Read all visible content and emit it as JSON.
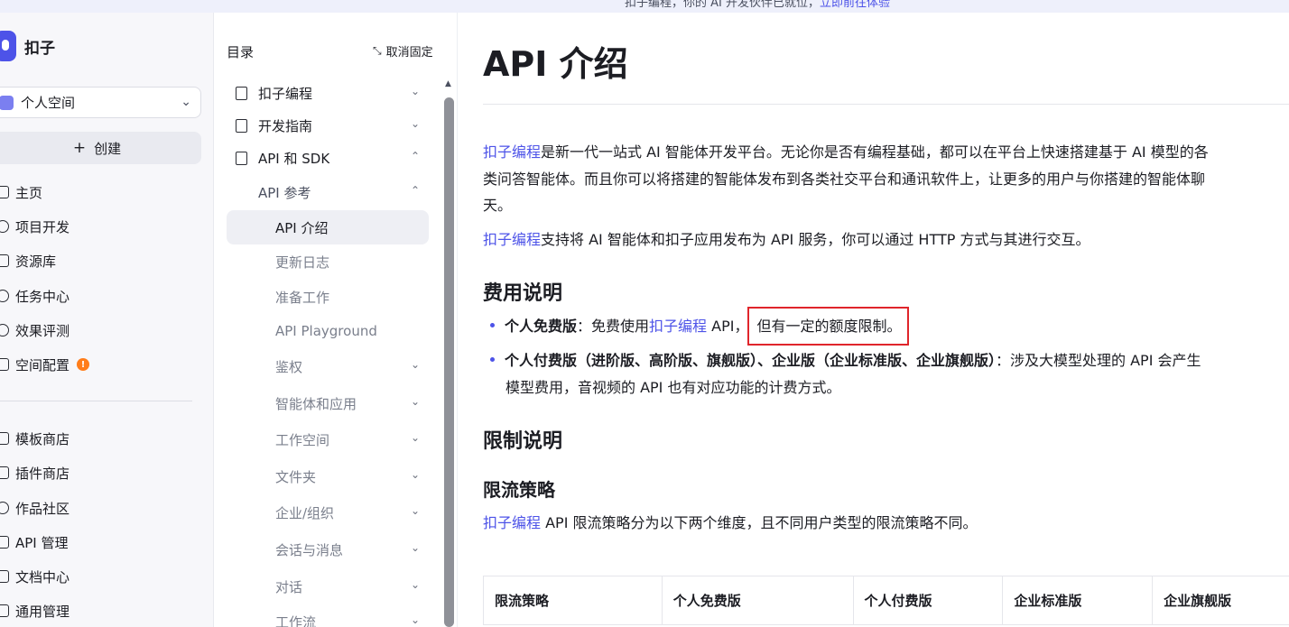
{
  "banner": {
    "text": "扣子编程，你的 AI 开发伙伴已就位，",
    "link": "立即前往体验"
  },
  "sidebar": {
    "brand": "扣子",
    "space": "个人空间",
    "create": "创建",
    "items": [
      {
        "label": "主页",
        "icon": "home-icon"
      },
      {
        "label": "项目开发",
        "icon": "project-icon"
      },
      {
        "label": "资源库",
        "icon": "library-icon"
      },
      {
        "label": "任务中心",
        "icon": "task-icon"
      },
      {
        "label": "效果评测",
        "icon": "evaluation-icon"
      },
      {
        "label": "空间配置",
        "icon": "settings-icon",
        "badge": "!"
      },
      {
        "label": "模板商店",
        "icon": "template-icon"
      },
      {
        "label": "插件商店",
        "icon": "plugin-icon"
      },
      {
        "label": "作品社区",
        "icon": "community-icon"
      },
      {
        "label": "API 管理",
        "icon": "api-icon"
      },
      {
        "label": "文档中心",
        "icon": "docs-icon"
      },
      {
        "label": "通用管理",
        "icon": "admin-icon"
      }
    ]
  },
  "toc": {
    "title": "目录",
    "unpin": "取消固定",
    "items": [
      {
        "label": "扣子编程"
      },
      {
        "label": "开发指南"
      },
      {
        "label": "API 和 SDK"
      },
      {
        "label": "API 参考"
      },
      {
        "label": "API 介绍"
      },
      {
        "label": "更新日志"
      },
      {
        "label": "准备工作"
      },
      {
        "label": "API Playground"
      },
      {
        "label": "鉴权"
      },
      {
        "label": "智能体和应用"
      },
      {
        "label": "工作空间"
      },
      {
        "label": "文件夹"
      },
      {
        "label": "企业/组织"
      },
      {
        "label": "会话与消息"
      },
      {
        "label": "对话"
      },
      {
        "label": "工作流"
      }
    ]
  },
  "content": {
    "title": "API 介绍",
    "intro1_link": "扣子编程",
    "intro1_text_a": "是新一代一站式 AI 智能体开发平台。无论你是否有编程基础，都可以在平台上快速搭建基于 AI 模型的各",
    "intro1_text_b": "类问答智能体。而且你可以将搭建的智能体发布到各类社交平台和通讯软件上，让更多的用户与你搭建的智能体聊",
    "intro1_text_c": "天。",
    "intro2_link": "扣子编程",
    "intro2_text": "支持将 AI 智能体和扣子应用发布为 API 服务，你可以通过 HTTP 方式与其进行交互。",
    "fee_heading": "费用说明",
    "fee_free_label": "个人免费版",
    "fee_free_text_a": "：免费使用",
    "fee_free_link": "扣子编程",
    "fee_free_text_b": " API，",
    "fee_free_highlight": "但有一定的额度限制。",
    "fee_paid_label": "个人付费版（进阶版、高阶版、旗舰版）、企业版（企业标准版、企业旗舰版）",
    "fee_paid_text_a": "：涉及大模型处理的 API 会产生",
    "fee_paid_text_b": "模型费用，音视频的 API 也有对应功能的计费方式。",
    "limit_heading": "限制说明",
    "rate_heading": "限流策略",
    "rate_link": "扣子编程",
    "rate_text": " API 限流策略分为以下两个维度，且不同用户类型的限流策略不同。",
    "table_headers": [
      "限流策略",
      "个人免费版",
      "个人付费版",
      "企业标准版",
      "企业旗舰版"
    ]
  }
}
